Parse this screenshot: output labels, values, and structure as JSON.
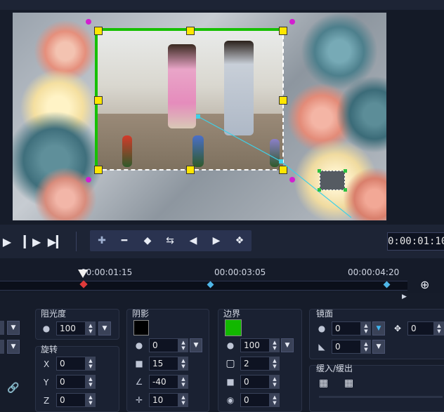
{
  "preview": {
    "alt": "Video frame with flower border overlay and photo of two children"
  },
  "transport": {
    "play_icon": "play-icon",
    "next_frame_icon": "next-frame-icon",
    "to_end_icon": "skip-end-icon",
    "timecode": "0:00:01:10"
  },
  "keyframe_toolbar": {
    "buttons": [
      "add-keyframe-icon",
      "remove-keyframe-icon",
      "reverse-keyframe-icon",
      "swap-keyframe-icon",
      "prev-keyframe-icon",
      "next-keyframe-icon",
      "copy-keyframe-icon"
    ]
  },
  "ruler": {
    "labels": [
      "00:00:01:15",
      "00:00:03:05",
      "00:00:04:20"
    ]
  },
  "opacity": {
    "title": "阻光度",
    "value": "100"
  },
  "rotation": {
    "title": "旋转",
    "x_label": "X",
    "x_value": "0",
    "y_label": "Y",
    "y_value": "0",
    "z_label": "Z",
    "z_value": "0"
  },
  "shadow": {
    "title": "阴影",
    "color": "#000000",
    "opacity": "0",
    "blur": "15",
    "angle": "-40",
    "distance": "10"
  },
  "border": {
    "title": "边界",
    "color": "#12b800",
    "opacity": "100",
    "width": "2",
    "value3": "0",
    "value4": "0"
  },
  "mirror": {
    "title": "镜面",
    "opacity": "0",
    "offset": "0",
    "value2": "0"
  },
  "ease": {
    "title": "缓入/缓出"
  },
  "left_partial": {
    "link_icon": "link-icon"
  }
}
